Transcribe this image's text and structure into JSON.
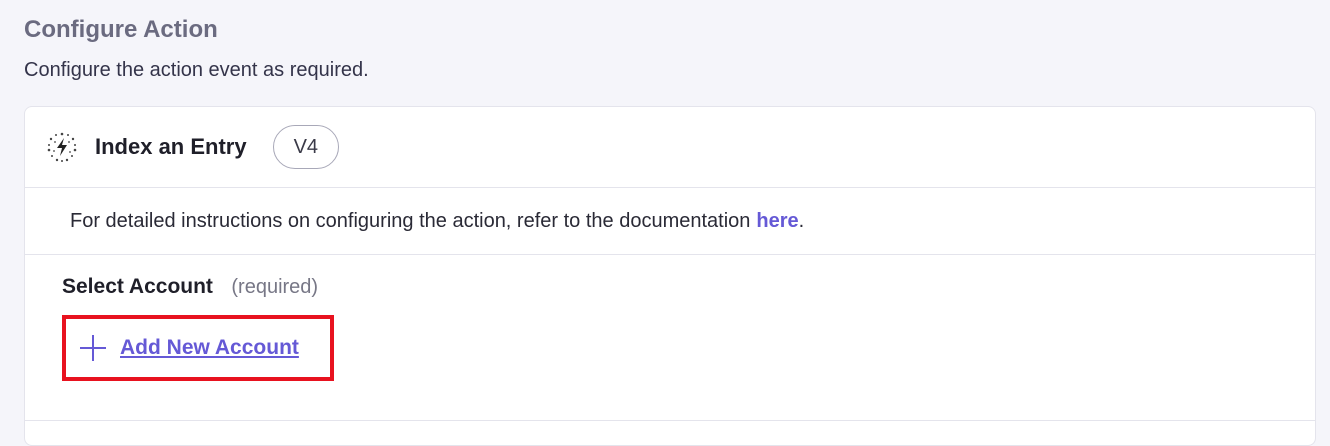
{
  "header": {
    "title": "Configure Action",
    "subtitle": "Configure the action event as required."
  },
  "action": {
    "icon": "sparkle-lightning-icon",
    "name": "Index an Entry",
    "version": "V4"
  },
  "documentation": {
    "text": "For detailed instructions on configuring the action, refer to the documentation",
    "link_label": "here",
    "suffix": "."
  },
  "account": {
    "label": "Select Account",
    "required_note": "(required)",
    "add_button_label": "Add New Account",
    "add_icon": "plus-icon"
  },
  "colors": {
    "accent": "#6559d6",
    "highlight_border": "#e8121f"
  }
}
